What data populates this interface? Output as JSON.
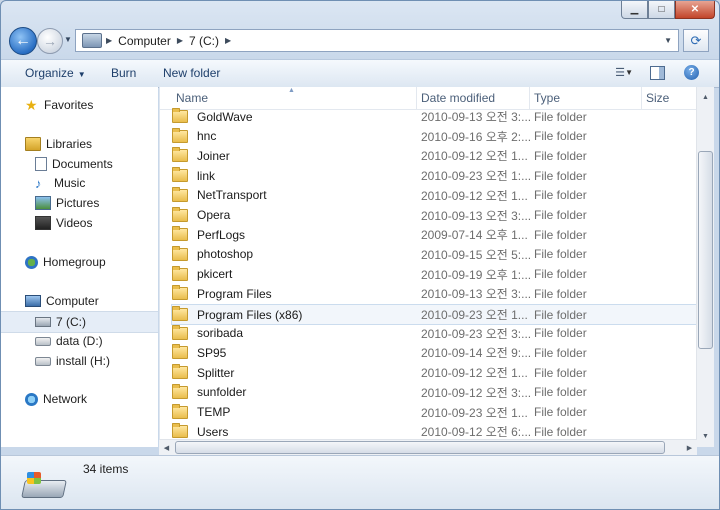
{
  "address": {
    "crumbs": [
      "Computer",
      "7 (C:)"
    ]
  },
  "toolbar": {
    "organize": "Organize",
    "burn": "Burn",
    "new_folder": "New folder"
  },
  "nav": {
    "favorites": "Favorites",
    "libraries": "Libraries",
    "documents": "Documents",
    "music": "Music",
    "pictures": "Pictures",
    "videos": "Videos",
    "homegroup": "Homegroup",
    "computer": "Computer",
    "drive_c": "7 (C:)",
    "drive_d": "data (D:)",
    "drive_h": "install (H:)",
    "network": "Network"
  },
  "columns": {
    "name": "Name",
    "date": "Date modified",
    "type": "Type",
    "size": "Size"
  },
  "files": [
    {
      "name": "GoldWave",
      "date": "2010-09-13 오전 3:...",
      "type": "File folder"
    },
    {
      "name": "hnc",
      "date": "2010-09-16 오후 2:...",
      "type": "File folder"
    },
    {
      "name": "Joiner",
      "date": "2010-09-12 오전 1...",
      "type": "File folder"
    },
    {
      "name": "link",
      "date": "2010-09-23 오전 1:...",
      "type": "File folder"
    },
    {
      "name": "NetTransport",
      "date": "2010-09-12 오전 1...",
      "type": "File folder"
    },
    {
      "name": "Opera",
      "date": "2010-09-13 오전 3:...",
      "type": "File folder"
    },
    {
      "name": "PerfLogs",
      "date": "2009-07-14 오후 1...",
      "type": "File folder"
    },
    {
      "name": "photoshop",
      "date": "2010-09-15 오전 5:...",
      "type": "File folder"
    },
    {
      "name": "pkicert",
      "date": "2010-09-19 오후 1:...",
      "type": "File folder"
    },
    {
      "name": "Program Files",
      "date": "2010-09-13 오전 3:...",
      "type": "File folder"
    },
    {
      "name": "Program Files (x86)",
      "date": "2010-09-23 오전 1...",
      "type": "File folder"
    },
    {
      "name": "soribada",
      "date": "2010-09-23 오전 3:...",
      "type": "File folder"
    },
    {
      "name": "SP95",
      "date": "2010-09-14 오전 9:...",
      "type": "File folder"
    },
    {
      "name": "Splitter",
      "date": "2010-09-12 오전 1...",
      "type": "File folder"
    },
    {
      "name": "sunfolder",
      "date": "2010-09-12 오전 3:...",
      "type": "File folder"
    },
    {
      "name": "TEMP",
      "date": "2010-09-23 오전 1...",
      "type": "File folder"
    },
    {
      "name": "Users",
      "date": "2010-09-12 오전 6:...",
      "type": "File folder"
    }
  ],
  "status": {
    "item_count": "34 items"
  }
}
